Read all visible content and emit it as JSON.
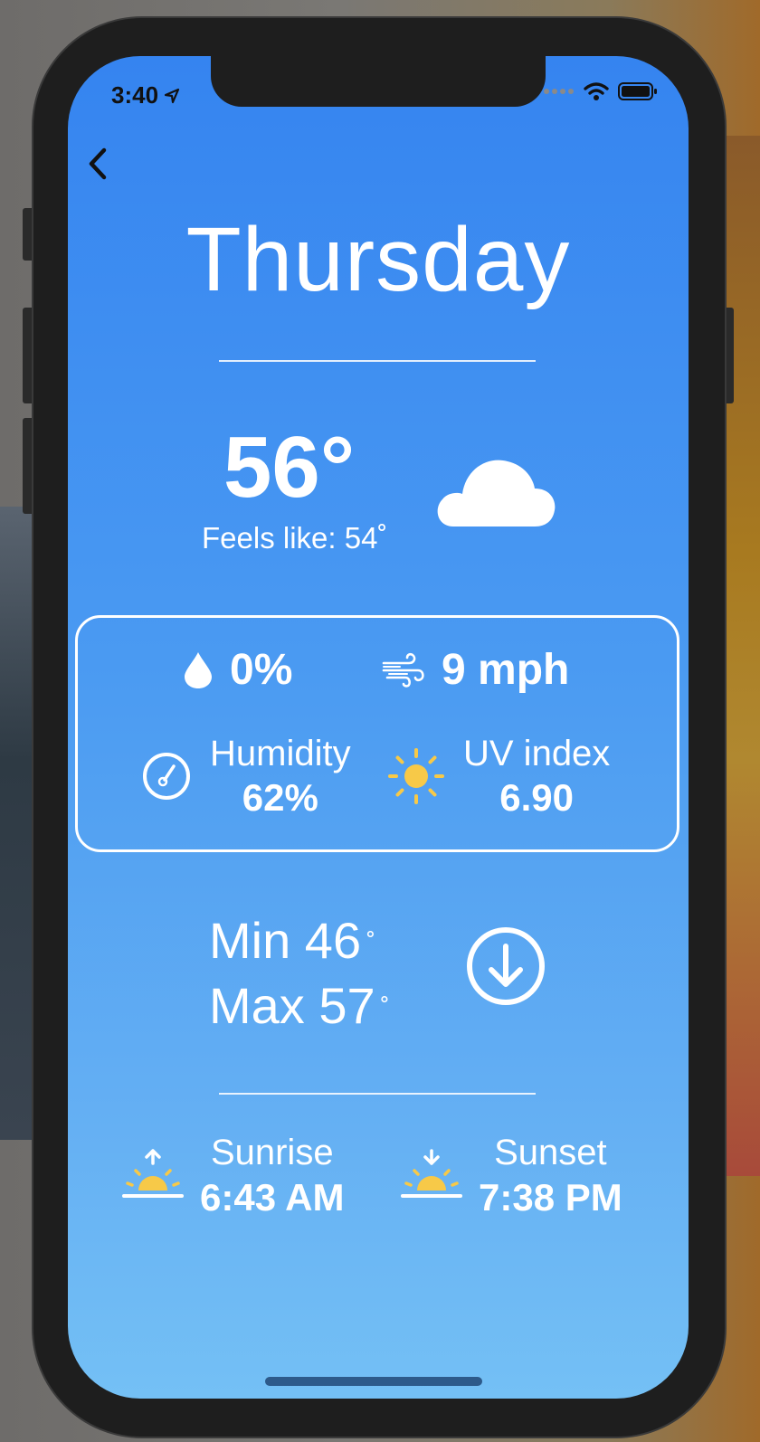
{
  "status_bar": {
    "time": "3:40"
  },
  "header": {
    "day": "Thursday"
  },
  "current": {
    "temperature": "56°",
    "feels_like": "Feels like: 54˚"
  },
  "conditions": {
    "precipitation": "0%",
    "wind": "9 mph",
    "humidity_label": "Humidity",
    "humidity_value": "62%",
    "uv_label": "UV index",
    "uv_value": "6.90"
  },
  "range": {
    "min_label": "Min 46",
    "max_label": "Max 57",
    "deg": "˚"
  },
  "sun": {
    "sunrise_label": "Sunrise",
    "sunrise_time": "6:43 AM",
    "sunset_label": "Sunset",
    "sunset_time": "7:38 PM"
  },
  "colors": {
    "sun_yellow": "#f7c948",
    "gradient_top": "#3584f0",
    "gradient_bottom": "#74c0f5"
  },
  "icons": [
    "back-chevron-icon",
    "cloud-icon",
    "drop-icon",
    "wind-icon",
    "gauge-icon",
    "sun-icon",
    "arrow-down-circle-icon",
    "sunrise-icon",
    "sunset-icon"
  ]
}
